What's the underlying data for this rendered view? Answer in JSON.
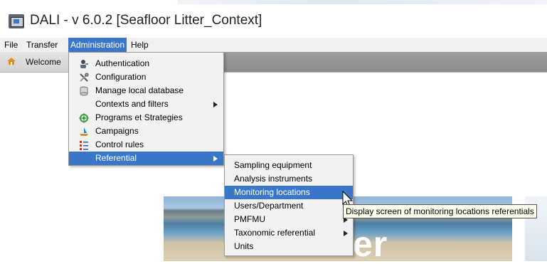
{
  "window": {
    "title": "DALI - v 6.0.2 [Seafloor Litter_Context]"
  },
  "menubar": {
    "items": [
      {
        "label": "File"
      },
      {
        "label": "Transfer"
      },
      {
        "label": "Administration"
      },
      {
        "label": "Help"
      }
    ]
  },
  "toolbar": {
    "welcome_label": "Welcome"
  },
  "admin_menu": {
    "items": [
      {
        "label": "Authentication",
        "icon": "user-key-icon"
      },
      {
        "label": "Configuration",
        "icon": "tools-icon"
      },
      {
        "label": "Manage local database",
        "icon": "database-icon"
      },
      {
        "label": "Contexts and filters",
        "icon": "",
        "submenu": true
      },
      {
        "label": "Programs et Strategies",
        "icon": "target-icon"
      },
      {
        "label": "Campaigns",
        "icon": "boat-icon"
      },
      {
        "label": "Control rules",
        "icon": "checklist-icon"
      },
      {
        "label": "Referential",
        "icon": "",
        "submenu": true,
        "selected": true
      }
    ]
  },
  "referential_menu": {
    "items": [
      {
        "label": "Sampling equipment"
      },
      {
        "label": "Analysis instruments"
      },
      {
        "label": "Monitoring locations",
        "selected": true
      },
      {
        "label": "Users/Department"
      },
      {
        "label": "PMFMU",
        "submenu": true
      },
      {
        "label": "Taxonomic referential",
        "submenu": true
      },
      {
        "label": "Units"
      }
    ]
  },
  "tooltip": {
    "text": "Display screen of monitoring locations referentials"
  },
  "background": {
    "banner_text": "er"
  },
  "colors": {
    "selection": "#3a77c8",
    "menu_bg": "#f2f2f2",
    "tooltip_bg": "#fffff0"
  }
}
